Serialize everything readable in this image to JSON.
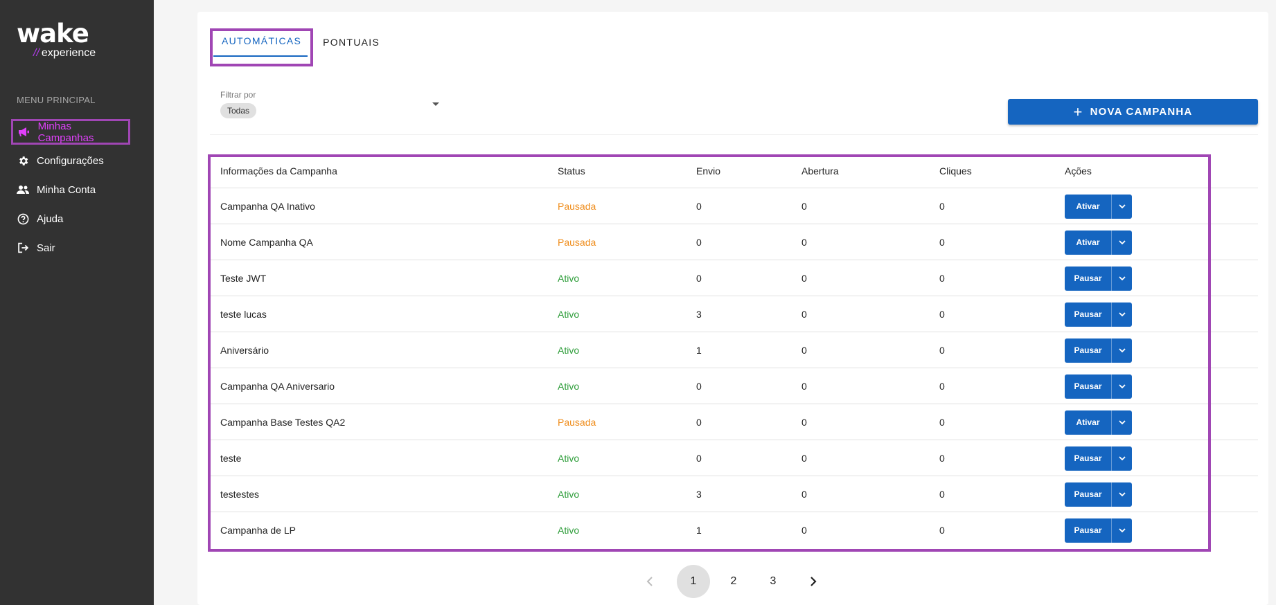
{
  "sidebar": {
    "logo_main": "wake",
    "logo_sub": "experience",
    "logo_slash": "//",
    "menu_title": "MENU PRINCIPAL",
    "items": [
      {
        "label": "Minhas Campanhas",
        "icon": "megaphone-icon"
      },
      {
        "label": "Configurações",
        "icon": "gear-icon"
      },
      {
        "label": "Minha Conta",
        "icon": "users-icon"
      },
      {
        "label": "Ajuda",
        "icon": "help-circle-icon"
      },
      {
        "label": "Sair",
        "icon": "logout-icon"
      }
    ]
  },
  "tabs": [
    "AUTOMÁTICAS",
    "PONTUAIS"
  ],
  "filter": {
    "label": "Filtrar por",
    "value": "Todas"
  },
  "new_campaign_label": "NOVA CAMPANHA",
  "table": {
    "headers": [
      "Informações da Campanha",
      "Status",
      "Envio",
      "Abertura",
      "Cliques",
      "Ações"
    ],
    "rows": [
      {
        "name": "Campanha QA Inativo",
        "status": "Pausada",
        "envio": "0",
        "abertura": "0",
        "cliques": "0",
        "action": "Ativar"
      },
      {
        "name": "Nome Campanha QA",
        "status": "Pausada",
        "envio": "0",
        "abertura": "0",
        "cliques": "0",
        "action": "Ativar"
      },
      {
        "name": "Teste JWT",
        "status": "Ativo",
        "envio": "0",
        "abertura": "0",
        "cliques": "0",
        "action": "Pausar"
      },
      {
        "name": "teste lucas",
        "status": "Ativo",
        "envio": "3",
        "abertura": "0",
        "cliques": "0",
        "action": "Pausar"
      },
      {
        "name": "Aniversário",
        "status": "Ativo",
        "envio": "1",
        "abertura": "0",
        "cliques": "0",
        "action": "Pausar"
      },
      {
        "name": "Campanha QA Aniversario",
        "status": "Ativo",
        "envio": "0",
        "abertura": "0",
        "cliques": "0",
        "action": "Pausar"
      },
      {
        "name": "Campanha Base Testes QA2",
        "status": "Pausada",
        "envio": "0",
        "abertura": "0",
        "cliques": "0",
        "action": "Ativar"
      },
      {
        "name": "teste",
        "status": "Ativo",
        "envio": "0",
        "abertura": "0",
        "cliques": "0",
        "action": "Pausar"
      },
      {
        "name": "testestes",
        "status": "Ativo",
        "envio": "3",
        "abertura": "0",
        "cliques": "0",
        "action": "Pausar"
      },
      {
        "name": "Campanha de LP",
        "status": "Ativo",
        "envio": "1",
        "abertura": "0",
        "cliques": "0",
        "action": "Pausar"
      }
    ]
  },
  "pagination": {
    "pages": [
      "1",
      "2",
      "3"
    ],
    "current": "1"
  },
  "colors": {
    "sidebar_bg": "#323232",
    "accent_blue": "#1565c0",
    "highlight_purple": "#a046b4",
    "active_menu": "#e040fb",
    "status_pausada": "#ef8c1a",
    "status_ativo": "#2e9d3a"
  }
}
